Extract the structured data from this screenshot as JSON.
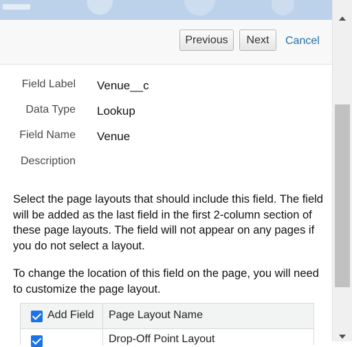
{
  "buttons": {
    "previous": "Previous",
    "next": "Next",
    "cancel": "Cancel"
  },
  "fields": [
    {
      "label": "Field Label",
      "value": "Venue__c"
    },
    {
      "label": "Data Type",
      "value": "Lookup"
    },
    {
      "label": "Field Name",
      "value": "Venue"
    },
    {
      "label": "Description",
      "value": ""
    }
  ],
  "instructions": {
    "paragraph1": "Select the page layouts that should include this field. The field will be added as the last field in the first 2-column section of these page layouts. The field will not appear on any pages if you do not select a layout.",
    "paragraph2": "To change the location of this field on the page, you will need to customize the page layout."
  },
  "table": {
    "header_add": "Add Field",
    "header_name": "Page Layout Name",
    "header_checked": true,
    "rows": [
      {
        "name": "Drop-Off Point Layout",
        "checked": true
      }
    ]
  },
  "colors": {
    "accent": "#1a73e8",
    "link": "#1f6fa8",
    "header_strip": "#bcd2ea"
  }
}
